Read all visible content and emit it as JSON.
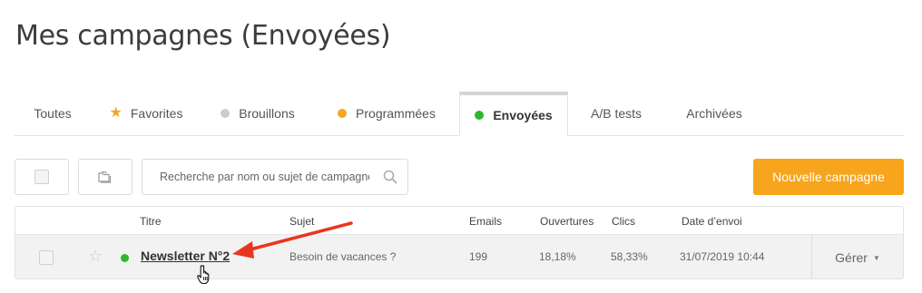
{
  "page": {
    "title": "Mes campagnes (Envoyées)"
  },
  "tabs": [
    {
      "label": "Toutes"
    },
    {
      "label": "Favorites",
      "icon": "star-icon",
      "color": "#f5a623"
    },
    {
      "label": "Brouillons",
      "icon": "dot",
      "color": "#cccccc"
    },
    {
      "label": "Programmées",
      "icon": "dot",
      "color": "#f5a623"
    },
    {
      "label": "Envoyées",
      "icon": "dot",
      "color": "#2eb82e",
      "active": true
    },
    {
      "label": "A/B tests"
    },
    {
      "label": "Archivées"
    }
  ],
  "toolbar": {
    "search_placeholder": "Recherche par nom ou sujet de campagne...",
    "new_campaign_label": "Nouvelle campagne",
    "accent_color": "#f7a51c"
  },
  "table": {
    "columns": {
      "title": "Titre",
      "subject": "Sujet",
      "emails": "Emails",
      "opens": "Ouvertures",
      "clicks": "Clics",
      "date": "Date d’envoi"
    },
    "rows": [
      {
        "title": "Newsletter N°2",
        "subject": "Besoin de vacances ?",
        "emails": "199",
        "opens": "18,18%",
        "clicks": "58,33%",
        "date": "31/07/2019 10:44",
        "status_color": "#2eb82e",
        "manage_label": "Gérer"
      }
    ]
  },
  "annotation": {
    "arrow_color": "#e8361e"
  }
}
